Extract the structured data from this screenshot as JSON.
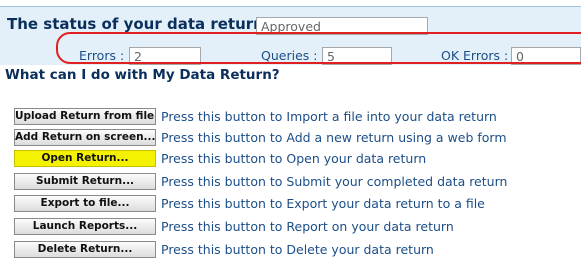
{
  "status": {
    "label": "The status of your data return :",
    "value": "Approved"
  },
  "counts": {
    "errors_label": "Errors :",
    "errors_value": "2",
    "queries_label": "Queries :",
    "queries_value": "5",
    "ok_errors_label": "OK Errors :",
    "ok_errors_value": "0"
  },
  "section_heading": "What can I do with My Data Return?",
  "actions": [
    {
      "button": "Upload Return from file...",
      "description": "Press this button to Import a file into your data return"
    },
    {
      "button": "Add Return on screen...",
      "description": "Press this button to Add a new return using a web form"
    },
    {
      "button": "Open Return...",
      "description": "Press this button to Open your data return"
    },
    {
      "button": "Submit Return...",
      "description": "Press this button to Submit your completed data return"
    },
    {
      "button": "Export to file...",
      "description": "Press this button to Export your data return to a file"
    },
    {
      "button": "Launch Reports...",
      "description": "Press this button to Report on your data return"
    },
    {
      "button": "Delete Return...",
      "description": "Press this button to Delete your data return"
    }
  ],
  "colors": {
    "highlight": "#f4f200",
    "annotation": "#e02020",
    "panel": "#e3f0f9"
  }
}
